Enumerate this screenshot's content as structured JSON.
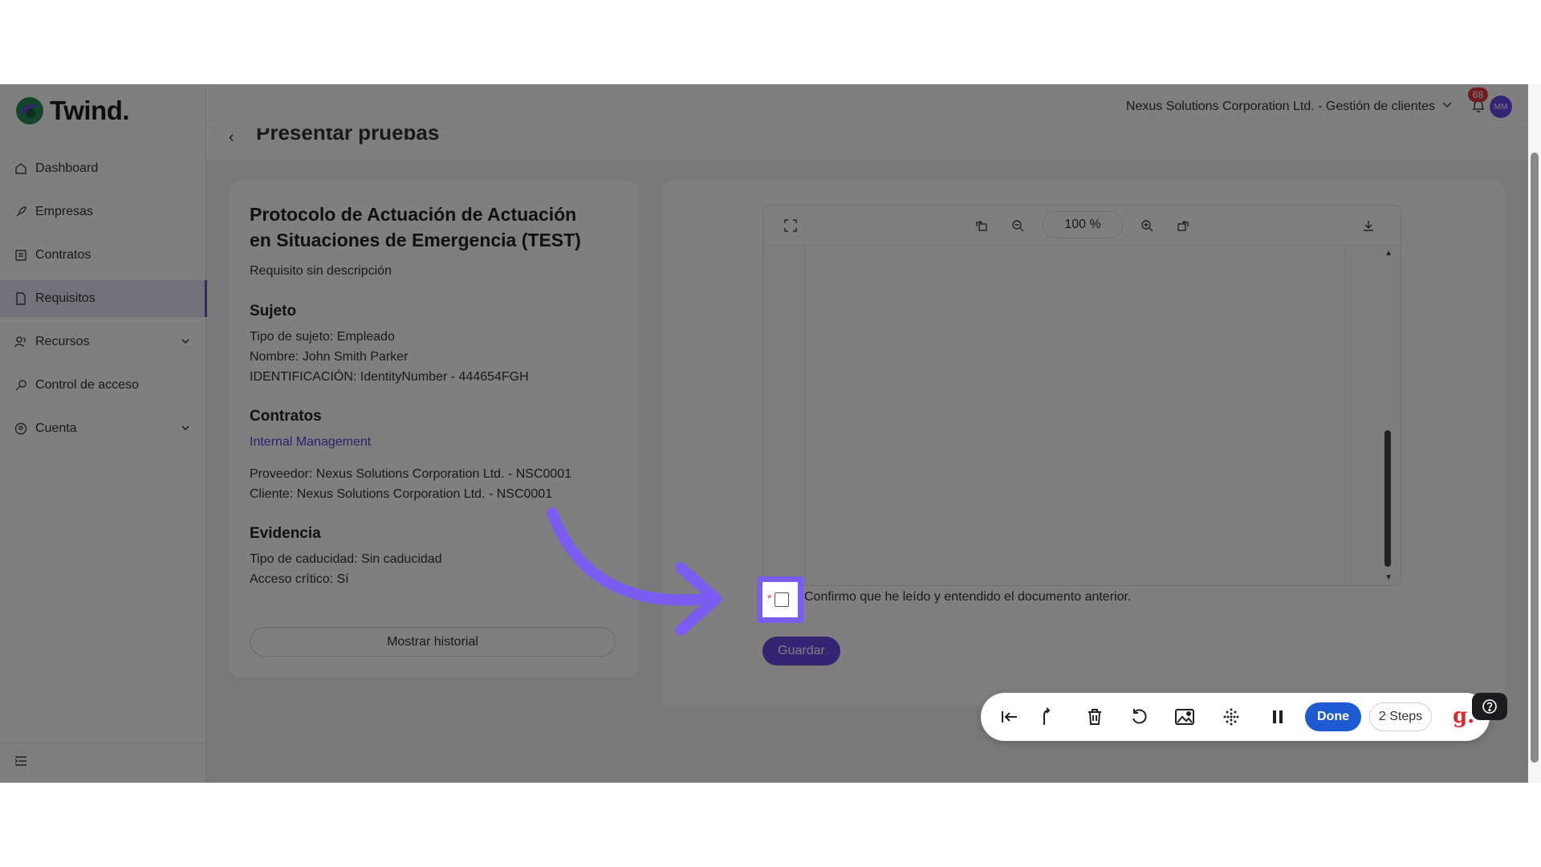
{
  "brand": {
    "name": "Twind."
  },
  "sidebar": {
    "items": [
      {
        "label": "Dashboard",
        "icon": "home-icon"
      },
      {
        "label": "Empresas",
        "icon": "rocket-icon"
      },
      {
        "label": "Contratos",
        "icon": "document-list-icon"
      },
      {
        "label": "Requisitos",
        "icon": "file-icon",
        "active": true
      },
      {
        "label": "Recursos",
        "icon": "users-icon",
        "expandable": true
      },
      {
        "label": "Control de acceso",
        "icon": "key-icon"
      },
      {
        "label": "Cuenta",
        "icon": "account-icon",
        "expandable": true
      }
    ]
  },
  "topbar": {
    "org": "Nexus Solutions Corporation Ltd. - Gestión de clientes",
    "notifications": "68",
    "avatar_initials": "MM"
  },
  "page": {
    "title": "Presentar pruebas"
  },
  "requirement": {
    "title": "Protocolo de Actuación de Actuación en Situaciones de Emergencia (TEST)",
    "description": "Requisito sin descripción",
    "subject_heading": "Sujeto",
    "subject_type": "Tipo de sujeto: Empleado",
    "subject_name": "Nombre: John Smith Parker",
    "subject_id": "IDENTIFICACIÓN: IdentityNumber - 444654FGH",
    "contracts_heading": "Contratos",
    "contract_link": "Internal Management",
    "provider": "Proveedor: Nexus Solutions Corporation Ltd. - NSC0001",
    "client": "Cliente: Nexus Solutions Corporation Ltd. - NSC0001",
    "evidence_heading": "Evidencia",
    "expiry_type": "Tipo de caducidad: Sin caducidad",
    "critical_access": "Acceso crítico: Sí",
    "history_button": "Mostrar historial"
  },
  "viewer": {
    "zoom": "100 %"
  },
  "confirm": {
    "text": "Confirmo que he leído y entendido el documento anterior.",
    "required_mark": "*"
  },
  "save_button": "Guardar",
  "recorder": {
    "done": "Done",
    "steps": "2 Steps",
    "logo": "g."
  },
  "colors": {
    "accent": "#6b46e6",
    "done_blue": "#1e5ad2",
    "badge_red": "#e23b3b"
  }
}
